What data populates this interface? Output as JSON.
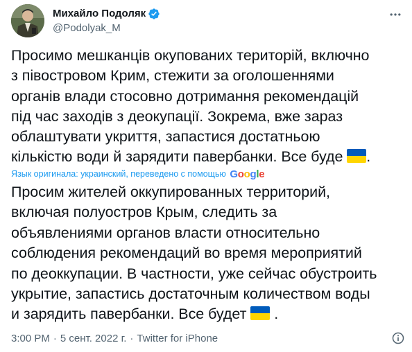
{
  "author": {
    "display_name": "Михайло Подоляк",
    "handle": "@Podolyak_M"
  },
  "icons": {
    "verified": "verified-badge-icon",
    "more": "more-options-icon",
    "info": "info-icon",
    "flag": "ukraine-flag-emoji"
  },
  "tweet": {
    "text_lines": [
      "Просимо мешканців окупованих територій, включно",
      "з півостровом Крим, стежити за оголошеннями",
      "органів влади стосовно дотримання рекомендацій",
      "під час заходів з деокупації. Зокрема, вже зараз",
      "облаштувати укриття, запастися достатньою",
      "кількістю води й зарядити павербанки. Все буде"
    ],
    "text_end": "."
  },
  "translation": {
    "note": "Язык оригинала: украинский, переведено с помощью",
    "provider": "Google",
    "text_lines": [
      "Просим жителей оккупированных территорий,",
      "включая полуостров Крым, следить за",
      "объявлениями органов власти относительно",
      "соблюдения рекомендаций во время мероприятий",
      "по деоккупации. В частности, уже сейчас обустроить",
      "укрытие, запастись достаточным количеством воды",
      "и зарядить павербанки. Все будет"
    ],
    "text_end": " ."
  },
  "meta": {
    "time": "3:00 PM",
    "separator": "·",
    "date": "5 сент. 2022 г.",
    "source": "Twitter for iPhone"
  },
  "colors": {
    "text": "#0f1419",
    "secondary": "#536471",
    "link": "#1d9bf0",
    "flag_blue": "#005bbb",
    "flag_yellow": "#ffd500"
  }
}
